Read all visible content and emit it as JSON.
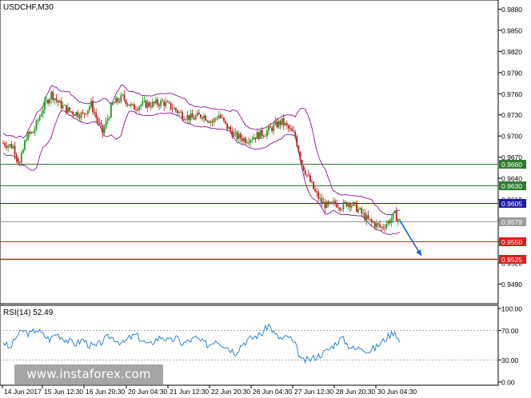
{
  "chart_data": [
    {
      "type": "candlestick",
      "title": "USDCHF,M30",
      "y_ticks": [
        "0.9880",
        "0.9850",
        "0.9820",
        "0.9790",
        "0.9760",
        "0.9730",
        "0.9700",
        "0.9670",
        "0.9640",
        "0.9610",
        "0.9580",
        "0.9550",
        "0.9520",
        "0.9490"
      ],
      "x_ticks": [
        "14 Jun 2017",
        "15 Jun 12:30",
        "16 Jun 20:30",
        "20 Jun 04:30",
        "21 Jun 12:30",
        "22 Jun 20:30",
        "26 Jun 04:30",
        "27 Jun 12:30",
        "28 Jun 20:30",
        "30 Jun 04:30"
      ],
      "ylim": [
        0.9462,
        0.9893
      ],
      "bar_count": 240,
      "price_path": [
        [
          0,
          0.969
        ],
        [
          6,
          0.9685
        ],
        [
          10,
          0.966
        ],
        [
          14,
          0.97
        ],
        [
          18,
          0.9705
        ],
        [
          24,
          0.974
        ],
        [
          29,
          0.976
        ],
        [
          34,
          0.9745
        ],
        [
          40,
          0.9735
        ],
        [
          48,
          0.973
        ],
        [
          53,
          0.9745
        ],
        [
          57,
          0.972
        ],
        [
          60,
          0.9705
        ],
        [
          66,
          0.9745
        ],
        [
          72,
          0.9755
        ],
        [
          78,
          0.974
        ],
        [
          84,
          0.9745
        ],
        [
          90,
          0.9745
        ],
        [
          96,
          0.9748
        ],
        [
          102,
          0.974
        ],
        [
          108,
          0.973
        ],
        [
          114,
          0.9725
        ],
        [
          120,
          0.973
        ],
        [
          126,
          0.972
        ],
        [
          130,
          0.973
        ],
        [
          134,
          0.9715
        ],
        [
          140,
          0.97
        ],
        [
          146,
          0.9695
        ],
        [
          152,
          0.97
        ],
        [
          158,
          0.9705
        ],
        [
          164,
          0.9715
        ],
        [
          168,
          0.972
        ],
        [
          172,
          0.971
        ],
        [
          176,
          0.97
        ],
        [
          180,
          0.966
        ],
        [
          184,
          0.964
        ],
        [
          188,
          0.962
        ],
        [
          192,
          0.9605
        ],
        [
          196,
          0.96
        ],
        [
          200,
          0.9605
        ],
        [
          204,
          0.96
        ],
        [
          208,
          0.9606
        ],
        [
          212,
          0.96
        ],
        [
          216,
          0.959
        ],
        [
          220,
          0.958
        ],
        [
          224,
          0.9575
        ],
        [
          228,
          0.957
        ],
        [
          232,
          0.9578
        ],
        [
          236,
          0.9588
        ],
        [
          239,
          0.9579
        ]
      ],
      "bands": {
        "upper_offset": 0.0028,
        "lower_offset": 0.0028
      },
      "horizontal_levels": [
        {
          "label": "0.9660",
          "value": 0.966,
          "color": "#2e7d2e",
          "label_bg": "#2e7d2e"
        },
        {
          "label": "0.9630",
          "value": 0.963,
          "color": "#2e7d2e",
          "label_bg": "#2e7d2e"
        },
        {
          "label": "0.9605",
          "value": 0.9605,
          "color": "#1a1aa6",
          "label_bg": "#1a1aa6"
        },
        {
          "label": "0.9579",
          "value": 0.9579,
          "color": "#9a9a9a",
          "label_bg": "#9a9a9a"
        },
        {
          "label": "0.9550",
          "value": 0.955,
          "color": "#e01b1b",
          "label_bg": "#e01b1b"
        },
        {
          "label": "0.9525",
          "value": 0.9525,
          "color": "#e01b1b",
          "label_bg": "#e01b1b"
        }
      ],
      "arrow": {
        "color": "#1565d8",
        "from_bar": 239,
        "from_value": 0.958,
        "to_bar": 252,
        "to_value": 0.953
      },
      "colors": {
        "bull": "#1f9b1f",
        "bear": "#c01b1b",
        "band": "#8b1a8b",
        "axis": "#000000"
      }
    },
    {
      "type": "line",
      "title": "RSI(14) 52.49",
      "y_ticks": [
        "100.00",
        "70.00",
        "30.00",
        "0.00"
      ],
      "ylim": [
        0,
        100
      ],
      "levels": [
        70,
        30
      ],
      "path": [
        [
          0,
          55
        ],
        [
          4,
          45
        ],
        [
          8,
          62
        ],
        [
          12,
          70
        ],
        [
          16,
          65
        ],
        [
          20,
          72
        ],
        [
          24,
          64
        ],
        [
          28,
          58
        ],
        [
          32,
          66
        ],
        [
          36,
          60
        ],
        [
          40,
          55
        ],
        [
          44,
          52
        ],
        [
          48,
          58
        ],
        [
          52,
          50
        ],
        [
          56,
          48
        ],
        [
          60,
          56
        ],
        [
          64,
          62
        ],
        [
          68,
          58
        ],
        [
          72,
          52
        ],
        [
          76,
          60
        ],
        [
          80,
          64
        ],
        [
          84,
          56
        ],
        [
          88,
          50
        ],
        [
          92,
          58
        ],
        [
          96,
          62
        ],
        [
          100,
          55
        ],
        [
          104,
          60
        ],
        [
          108,
          52
        ],
        [
          112,
          56
        ],
        [
          116,
          60
        ],
        [
          120,
          54
        ],
        [
          124,
          50
        ],
        [
          128,
          58
        ],
        [
          132,
          52
        ],
        [
          136,
          46
        ],
        [
          140,
          40
        ],
        [
          144,
          52
        ],
        [
          148,
          58
        ],
        [
          152,
          62
        ],
        [
          156,
          66
        ],
        [
          160,
          78
        ],
        [
          164,
          64
        ],
        [
          168,
          58
        ],
        [
          172,
          62
        ],
        [
          176,
          50
        ],
        [
          180,
          28
        ],
        [
          184,
          30
        ],
        [
          188,
          34
        ],
        [
          192,
          38
        ],
        [
          196,
          44
        ],
        [
          200,
          52
        ],
        [
          204,
          60
        ],
        [
          208,
          50
        ],
        [
          212,
          44
        ],
        [
          216,
          48
        ],
        [
          220,
          42
        ],
        [
          224,
          46
        ],
        [
          228,
          54
        ],
        [
          232,
          62
        ],
        [
          236,
          70
        ],
        [
          239,
          53
        ]
      ],
      "color": "#1f78d0"
    }
  ],
  "watermark": "www.instaforex.com"
}
